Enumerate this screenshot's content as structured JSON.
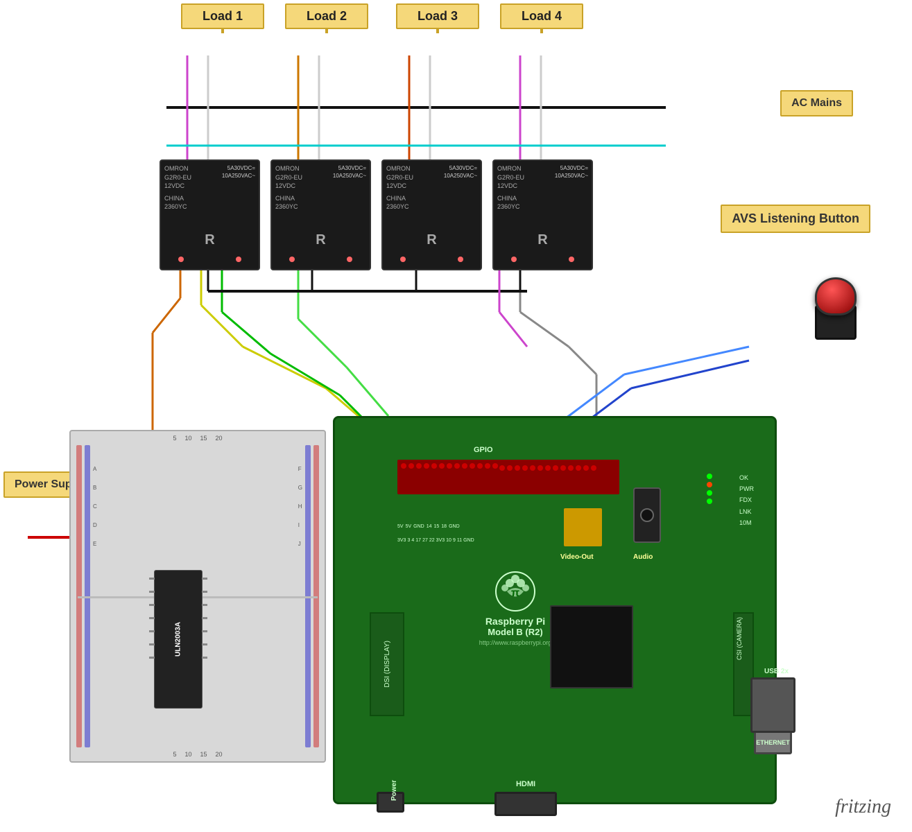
{
  "labels": {
    "load1": "Load 1",
    "load2": "Load 2",
    "load3": "Load 3",
    "load4": "Load 4",
    "acMains": "AC Mains",
    "avsButton": "AVS Listening Button",
    "powerSupply": "Power Supply for Relay",
    "rpiModel": "Raspberry Pi",
    "rpiModelLine2": "Model B (R2)",
    "rpiUrl": "http://www.raspberrypi.org",
    "fritzing": "fritzing",
    "videoOut": "Video-Out",
    "audio": "Audio",
    "hdmi": "HDMI",
    "ethernet": "ETHERNET",
    "usb": "USB 2x",
    "power": "Power",
    "dsiDisplay": "DSI (DISPLAY)",
    "csiCamera": "CSI (CAMERA)",
    "ulnChip": "ULN2003A"
  },
  "colors": {
    "stickyYellow": "#f5d87a",
    "stickyBorder": "#c9a227",
    "rpiGreen": "#1a7a1a",
    "relayBlack": "#1a1a1a",
    "breadboardGray": "#d0d0d0"
  }
}
